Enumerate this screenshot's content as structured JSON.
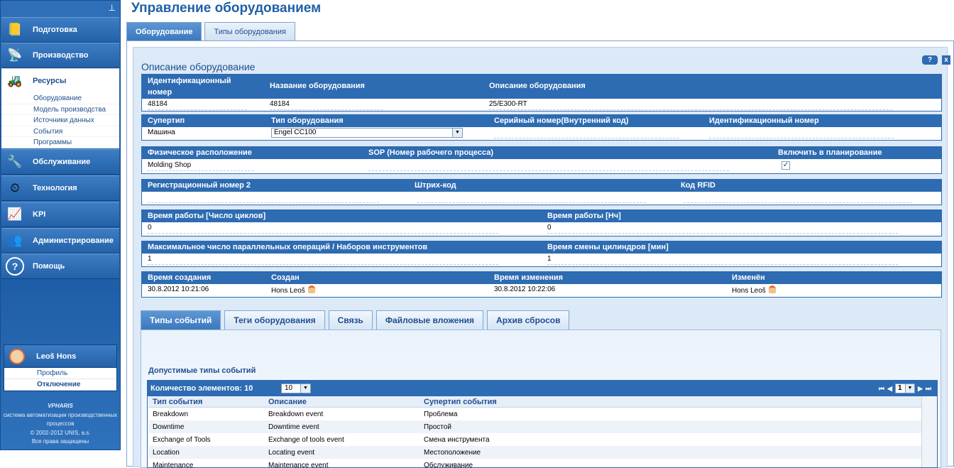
{
  "sidebar": {
    "pin_icon": "pin-icon",
    "nav": [
      {
        "label": "Подготовка",
        "icon": "book-icon",
        "active": false
      },
      {
        "label": "Производство",
        "icon": "satellite-icon",
        "active": false
      },
      {
        "label": "Ресурсы",
        "icon": "forklift-icon",
        "active": true
      },
      {
        "label": "Обслуживание",
        "icon": "tools-icon",
        "active": false
      },
      {
        "label": "Технология",
        "icon": "gauge-icon",
        "active": false
      },
      {
        "label": "KPI",
        "icon": "chart-icon",
        "active": false
      },
      {
        "label": "Администрирование",
        "icon": "users-icon",
        "active": false
      },
      {
        "label": "Помощь",
        "icon": "help-icon",
        "active": false
      }
    ],
    "subnav": [
      "Оборудование",
      "Модель производства",
      "Источники данных",
      "События",
      "Программы"
    ],
    "user": {
      "name": "Leoš  Hons",
      "profile": "Профиль",
      "logout": "Отключение"
    },
    "footer": {
      "brand": "VPHARIS",
      "line1": "система автоматизации производственных",
      "line2": "процессов",
      "copyright": "© 2002-2012 UNIS, a.s.",
      "rights": "Все права защищены"
    }
  },
  "page": {
    "title": "Управление оборудованием",
    "tabs": [
      {
        "label": "Оборудование"
      },
      {
        "label": "Типы оборудования"
      }
    ],
    "help": "?",
    "close": "x",
    "section_title": "Описание оборудование"
  },
  "form": {
    "row1": {
      "h_id_line1": "Идентификационный",
      "h_id_line2": "номер",
      "h_name": "Название оборудования",
      "h_desc": "Описание оборудования",
      "v_id": "48184",
      "v_name": "48184",
      "v_desc": "25/E300-RT"
    },
    "row2": {
      "h_supertype": "Супертип",
      "h_type": "Тип оборудования",
      "h_serial": "Серийный номер(Внутренний код)",
      "h_ident": "Идентификационный номер",
      "v_supertype": "Машина",
      "v_type": "Engel CC100",
      "v_serial": "",
      "v_ident": ""
    },
    "row3": {
      "h_location": "Физическое расположение",
      "h_sop": "SOP (Номер рабочего процесса)",
      "h_plan": "Включить в планирование",
      "v_location": "Molding Shop",
      "v_sop": "",
      "plan_checked": "✓"
    },
    "row4": {
      "h_reg2": "Регистрационный номер 2",
      "h_barcode": "Штрих-код",
      "h_rfid": "Код RFID",
      "v_reg2": "",
      "v_barcode": "",
      "v_rfid": ""
    },
    "row5": {
      "h_cycles": "Время работы [Число циклов]",
      "h_hours": "Время работы [Нч]",
      "v_cycles": "0",
      "v_hours": "0"
    },
    "row6": {
      "h_parallel": "Максимальное число параллельных операций / Наборов инструментов",
      "h_cylinder": "Время смены цилиндров [мин]",
      "v_parallel": "1",
      "v_cylinder": "1"
    },
    "row7": {
      "h_created": "Время создания",
      "h_creator": "Создан",
      "h_modified": "Время изменения",
      "h_modifier": "Изменён",
      "v_created": "30.8.2012 10:21:06",
      "v_creator": "Hons Leoš",
      "v_modified": "30.8.2012 10:22:06",
      "v_modifier": "Hons Leoš"
    }
  },
  "detail_tabs": [
    {
      "label": "Типы событий"
    },
    {
      "label": "Теги оборудования"
    },
    {
      "label": "Связь"
    },
    {
      "label": "Файловые вложения"
    },
    {
      "label": "Архив сбросов"
    }
  ],
  "events": {
    "title": "Допустимые типы событий",
    "count_label": "Количество элементов: 10",
    "page_size": "10",
    "page": "1",
    "columns": [
      "Тип события",
      "Описание",
      "Супертип события"
    ],
    "rows": [
      [
        "Breakdown",
        "Breakdown event",
        "Проблема"
      ],
      [
        "Downtime",
        "Downtime event",
        "Простой"
      ],
      [
        "Exchange of Tools",
        "Exchange of tools event",
        "Смена инструмента"
      ],
      [
        "Location",
        "Locating event",
        "Местоположение"
      ],
      [
        "Maintenance",
        "Maintenance event",
        "Обслуживание"
      ]
    ]
  },
  "colors": {
    "primary": "#2d6bb2",
    "title": "#1f5fa6",
    "sidebar": "#1b5aa3"
  }
}
